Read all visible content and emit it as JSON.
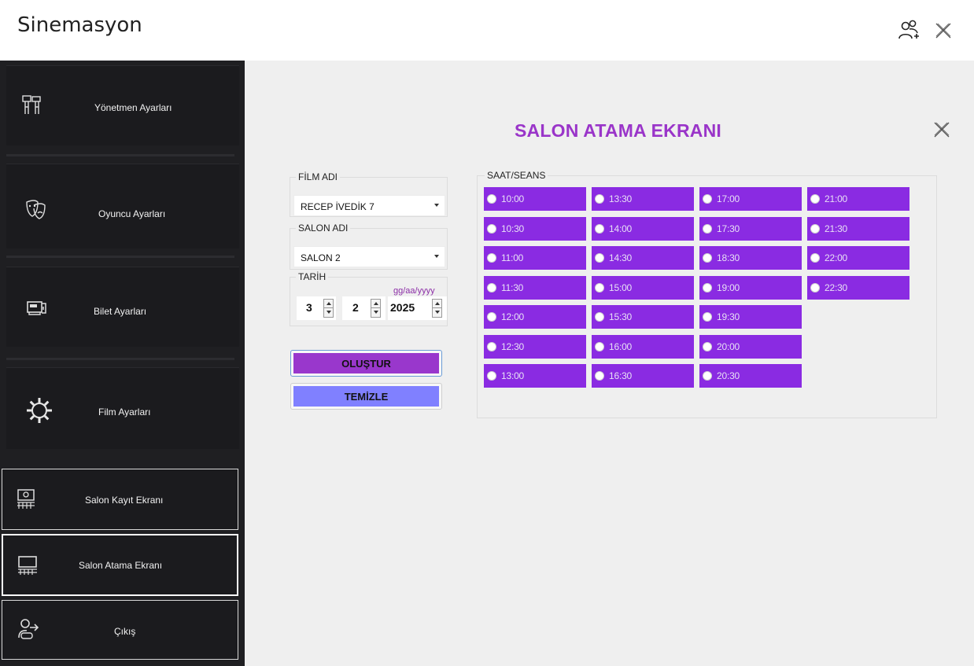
{
  "app": {
    "title": "Sinemasyon"
  },
  "sidebar": {
    "items": [
      {
        "label": "Yönetmen  Ayarları",
        "icon": "director-icon"
      },
      {
        "label": "Oyuncu Ayarları",
        "icon": "theater-masks-icon"
      },
      {
        "label": "Bilet Ayarları",
        "icon": "ticket-machine-icon"
      },
      {
        "label": "Film Ayarları",
        "icon": "gear-icon"
      }
    ],
    "screens": [
      {
        "label": "Salon Kayıt Ekranı",
        "icon": "cinema-hall-icon"
      },
      {
        "label": "Salon Atama Ekranı",
        "icon": "cinema-screen-icon"
      },
      {
        "label": "Çıkış",
        "icon": "exit-user-icon"
      }
    ]
  },
  "screen": {
    "title": "SALON ATAMA EKRANI",
    "film": {
      "group_label": "FİLM ADI",
      "value": "RECEP İVEDİK 7"
    },
    "salon": {
      "group_label": "SALON ADI",
      "value": "SALON 2"
    },
    "date": {
      "group_label": "TARİH",
      "hint": "gg/aa/yyyy",
      "day": "3",
      "month": "2",
      "year": "2025"
    },
    "buttons": {
      "create": "OLUŞTUR",
      "clear": "TEMİZLE"
    },
    "seans": {
      "group_label": "SAAT/SEANS",
      "columns": [
        [
          "10:00",
          "10:30",
          "11:00",
          "11:30",
          "12:00",
          "12:30",
          "13:00"
        ],
        [
          "13:30",
          "14:00",
          "14:30",
          "15:00",
          "15:30",
          "16:00",
          "16:30"
        ],
        [
          "17:00",
          "17:30",
          "18:30",
          "19:00",
          "19:30",
          "20:00",
          "20:30"
        ],
        [
          "21:00",
          "21:30",
          "22:00",
          "22:30"
        ]
      ]
    }
  },
  "colors": {
    "accent": "#8a2be2",
    "title": "#9a35c9",
    "create_button": "#9937cc",
    "clear_button": "#8080ff",
    "sidebar": "#1f1f22"
  }
}
